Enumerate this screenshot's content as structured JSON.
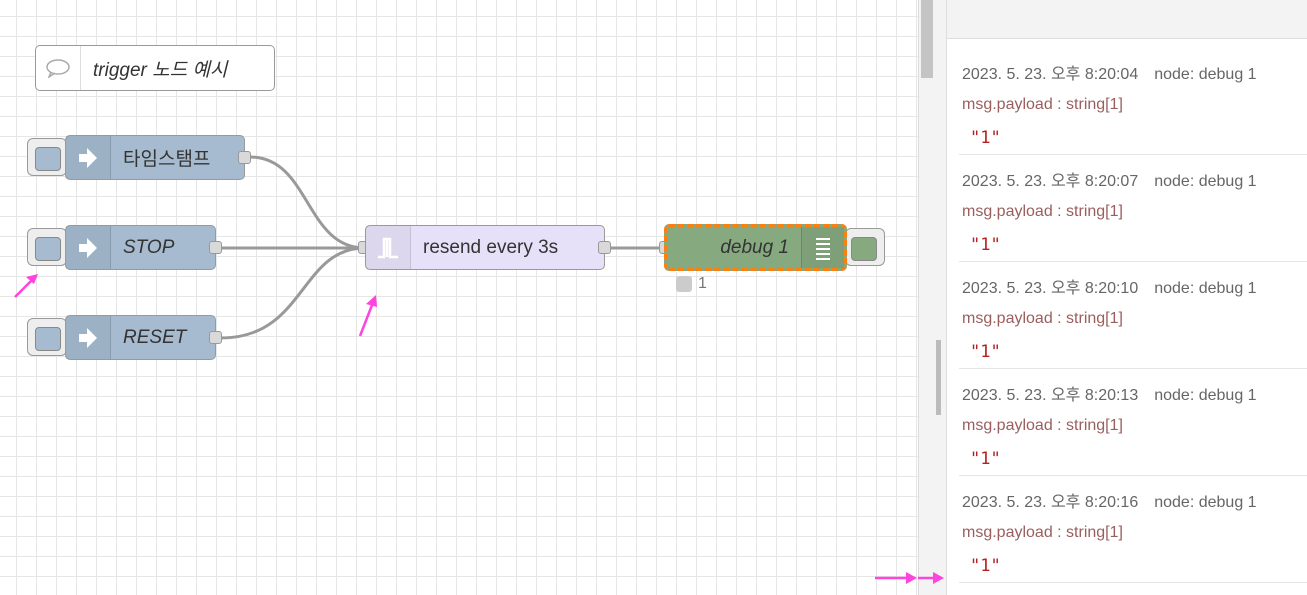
{
  "flow": {
    "comment": {
      "label": "trigger 노드 예시",
      "icon": "speech-bubble-icon"
    },
    "inject_nodes": [
      {
        "label": "타임스탬프",
        "italic": false,
        "icon": "arrow-right-icon"
      },
      {
        "label": "STOP",
        "italic": true,
        "icon": "arrow-right-icon"
      },
      {
        "label": "RESET",
        "italic": true,
        "icon": "arrow-right-icon"
      }
    ],
    "trigger_node": {
      "label": "resend every 3s",
      "icon": "trigger-pulse-icon"
    },
    "debug_node": {
      "label": "debug 1",
      "icon": "list-lines-icon",
      "status_text": "1",
      "selected": true
    },
    "colors": {
      "inject": "#a6bbcf",
      "trigger": "#e6e0f8",
      "debug": "#87a980",
      "selection": "#ff7f0e",
      "annotation_arrow": "#ff44dd"
    }
  },
  "debug_sidebar": {
    "messages": [
      {
        "timestamp": "2023. 5. 23. 오후 8:20:04",
        "node": "node: debug 1",
        "path": "msg.payload : string[1]",
        "value": "\"1\""
      },
      {
        "timestamp": "2023. 5. 23. 오후 8:20:07",
        "node": "node: debug 1",
        "path": "msg.payload : string[1]",
        "value": "\"1\""
      },
      {
        "timestamp": "2023. 5. 23. 오후 8:20:10",
        "node": "node: debug 1",
        "path": "msg.payload : string[1]",
        "value": "\"1\""
      },
      {
        "timestamp": "2023. 5. 23. 오후 8:20:13",
        "node": "node: debug 1",
        "path": "msg.payload : string[1]",
        "value": "\"1\""
      },
      {
        "timestamp": "2023. 5. 23. 오후 8:20:16",
        "node": "node: debug 1",
        "path": "msg.payload : string[1]",
        "value": "\"1\""
      }
    ]
  }
}
